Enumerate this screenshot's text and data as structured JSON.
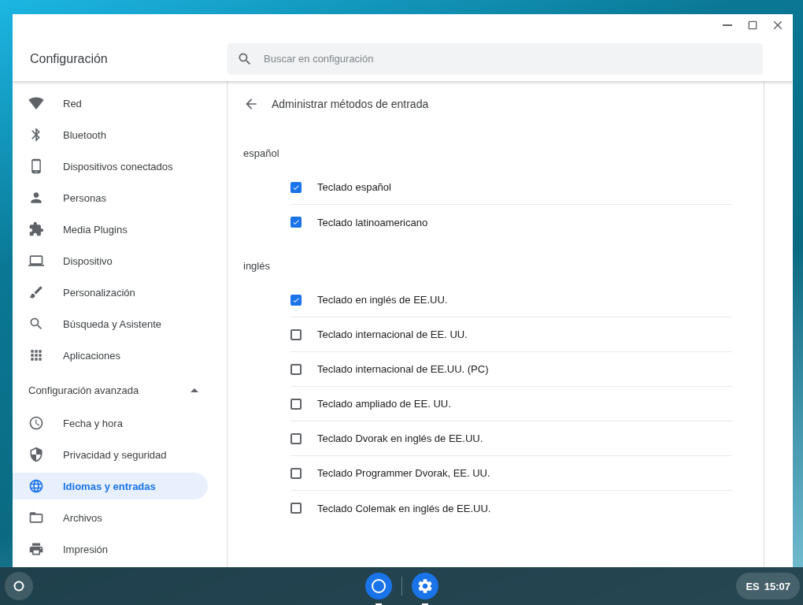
{
  "window": {
    "title": "Configuración"
  },
  "search": {
    "placeholder": "Buscar en configuración"
  },
  "sidebar": {
    "items": [
      {
        "label": "Red",
        "selected": false
      },
      {
        "label": "Bluetooth",
        "selected": false
      },
      {
        "label": "Dispositivos conectados",
        "selected": false
      },
      {
        "label": "Personas",
        "selected": false
      },
      {
        "label": "Media Plugins",
        "selected": false
      },
      {
        "label": "Dispositivo",
        "selected": false
      },
      {
        "label": "Personalización",
        "selected": false
      },
      {
        "label": "Búsqueda y Asistente",
        "selected": false
      },
      {
        "label": "Aplicaciones",
        "selected": false
      }
    ],
    "advanced": {
      "label": "Configuración avanzada",
      "expanded": true,
      "items": [
        {
          "label": "Fecha y hora",
          "selected": false
        },
        {
          "label": "Privacidad y seguridad",
          "selected": false
        },
        {
          "label": "Idiomas y entradas",
          "selected": true
        },
        {
          "label": "Archivos",
          "selected": false
        },
        {
          "label": "Impresión",
          "selected": false
        }
      ]
    }
  },
  "page": {
    "title": "Administrar métodos de entrada",
    "groups": [
      {
        "language": "español",
        "methods": [
          {
            "label": "Teclado español",
            "checked": true
          },
          {
            "label": "Teclado latinoamericano",
            "checked": true
          }
        ]
      },
      {
        "language": "inglés",
        "methods": [
          {
            "label": "Teclado en inglés de EE.UU.",
            "checked": true
          },
          {
            "label": "Teclado internacional de EE. UU.",
            "checked": false
          },
          {
            "label": "Teclado internacional de EE.UU. (PC)",
            "checked": false
          },
          {
            "label": "Teclado ampliado de EE. UU.",
            "checked": false
          },
          {
            "label": "Teclado Dvorak en inglés de EE.UU.",
            "checked": false
          },
          {
            "label": "Teclado Programmer Dvorak, EE. UU.",
            "checked": false
          },
          {
            "label": "Teclado Colemak en inglés de EE.UU.",
            "checked": false
          }
        ]
      }
    ]
  },
  "shelf": {
    "tray": {
      "language": "ES",
      "time": "15:07"
    }
  }
}
